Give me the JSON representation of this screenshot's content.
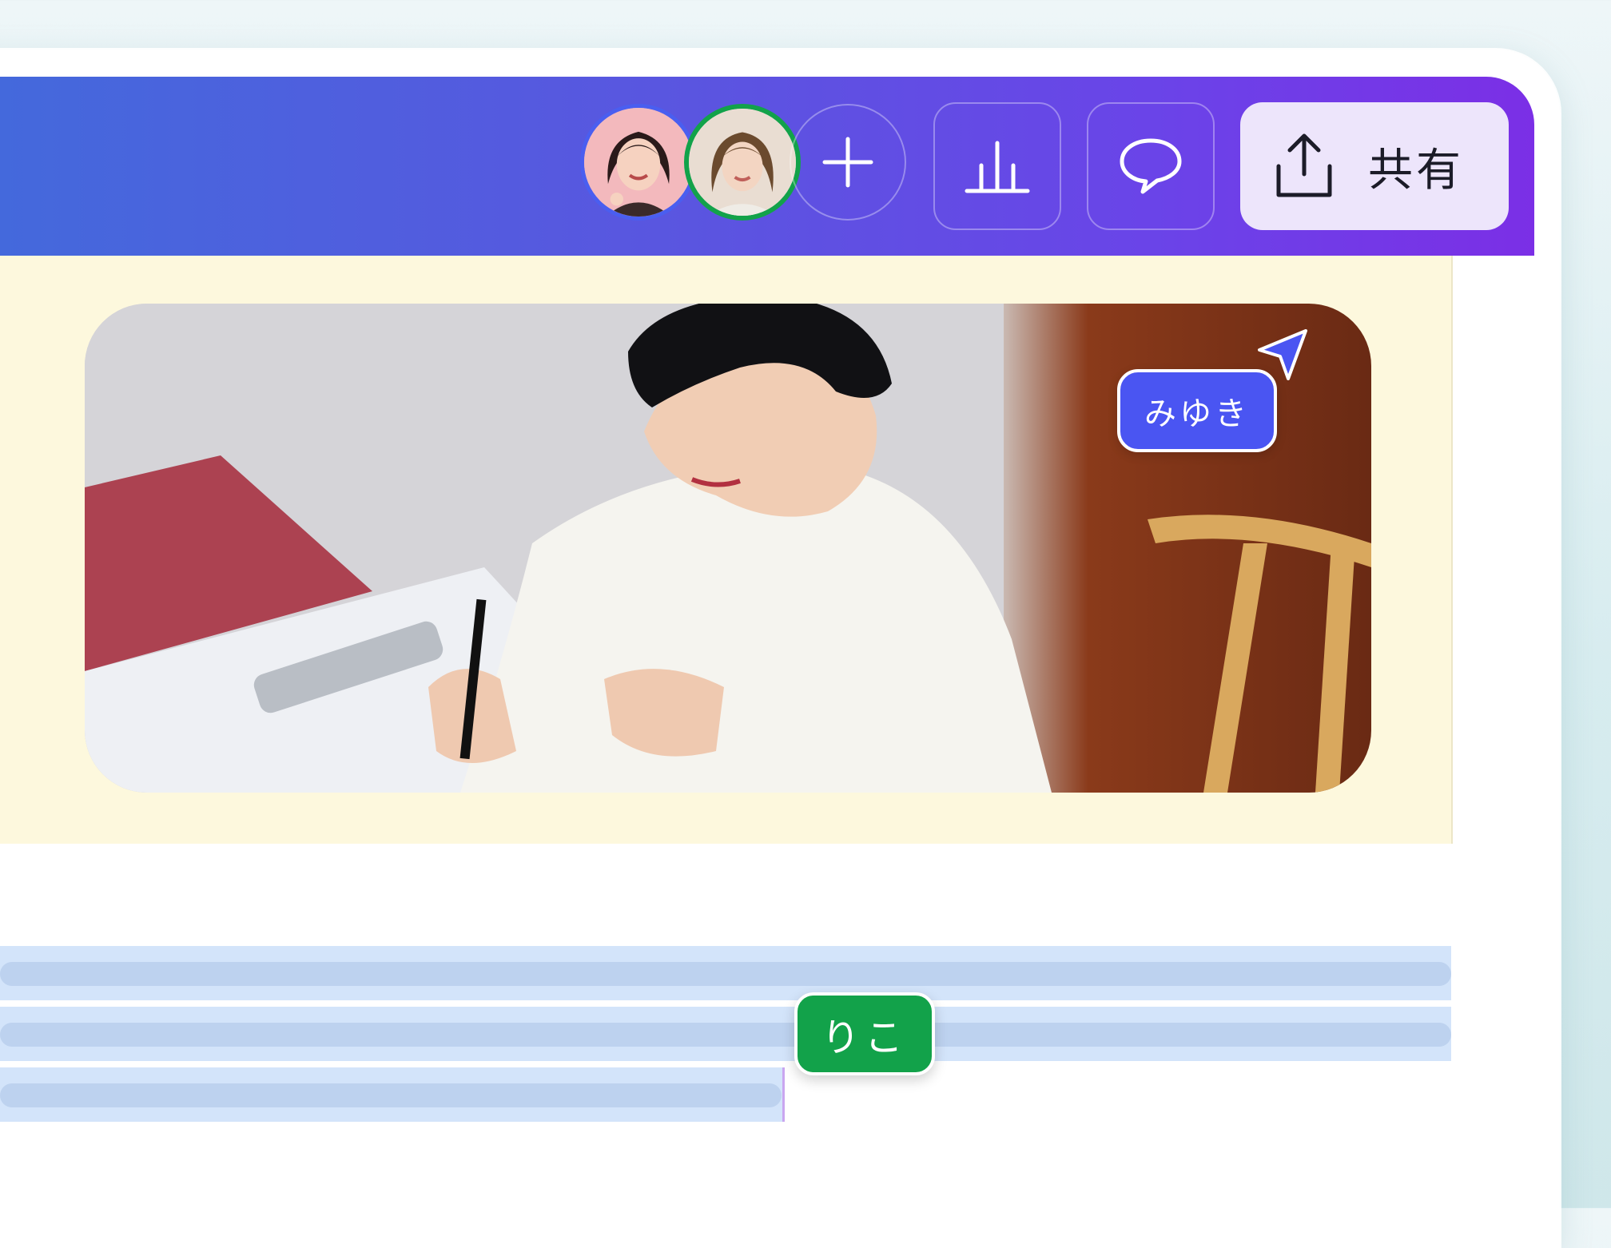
{
  "toolbar": {
    "collaborators": [
      {
        "name": "collaborator-1",
        "ring_color": "#4a5ef0"
      },
      {
        "name": "collaborator-2",
        "ring_color": "#12a24a"
      }
    ],
    "add_icon": "plus-icon",
    "analytics_icon": "bar-chart-icon",
    "comment_icon": "speech-bubble-icon",
    "share_icon": "upload-icon",
    "share_label": "共有"
  },
  "canvas": {
    "photo_description_icon": "photo",
    "cursors": [
      {
        "label": "みゆき",
        "color": "#4a55f2",
        "icon": "cursor-arrow-icon"
      },
      {
        "label": "りこ",
        "color": "#12a24a"
      }
    ]
  },
  "colors": {
    "toolbar_start": "#4469dc",
    "toolbar_end": "#7b2fe6",
    "hero_background": "#fdf8dd",
    "selection": "#d3e4fa"
  }
}
